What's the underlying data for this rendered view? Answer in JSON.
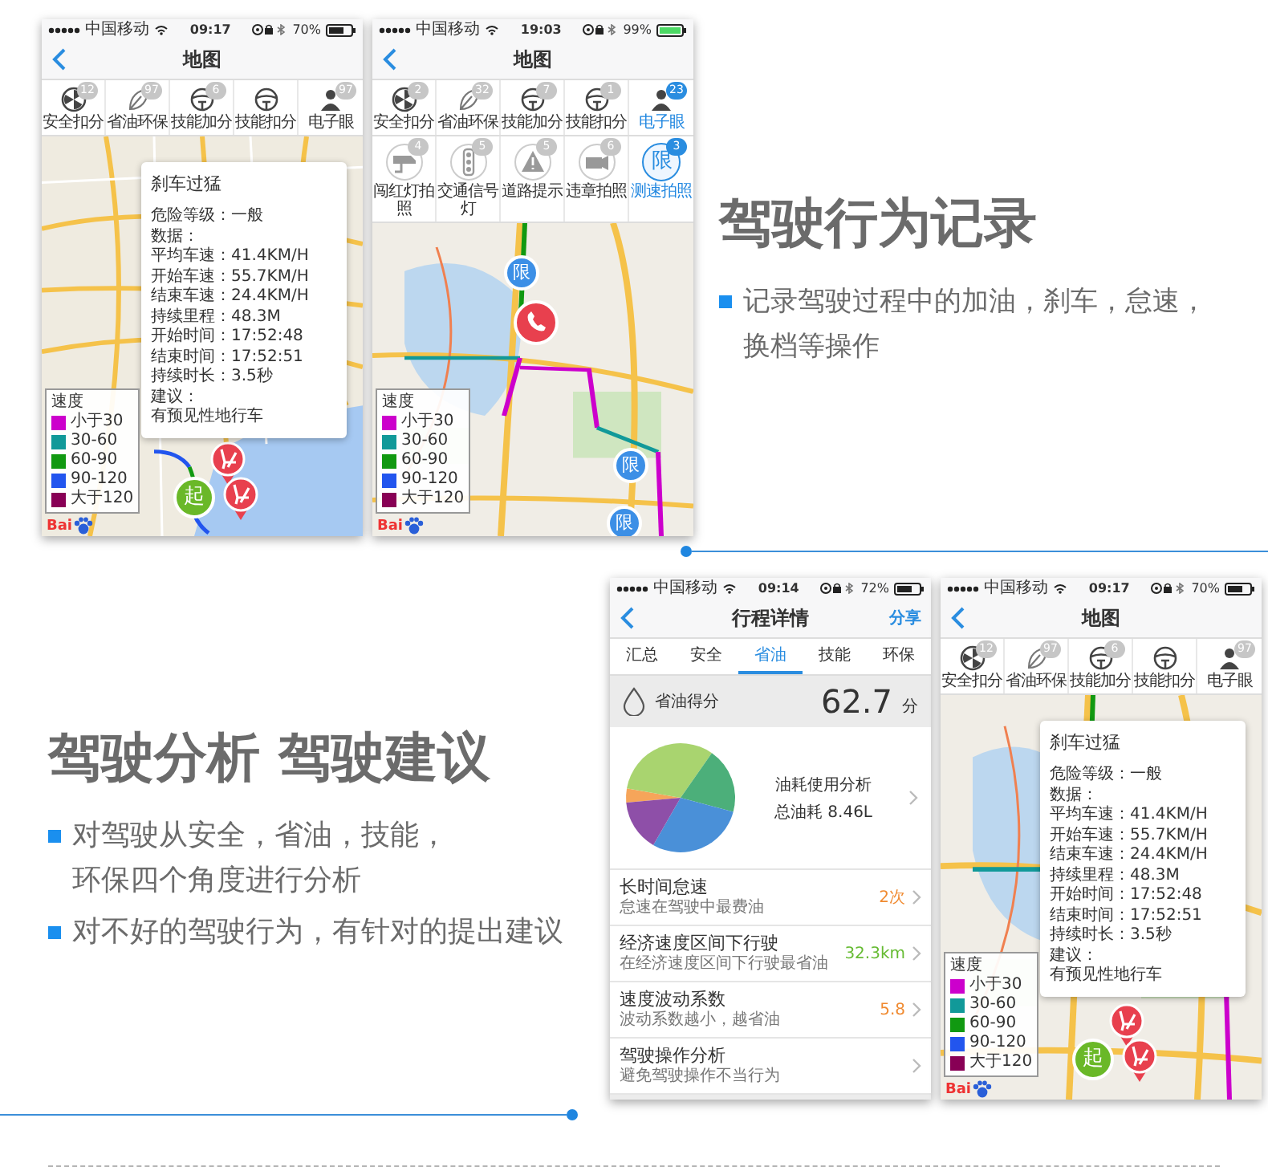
{
  "sections": [
    {
      "kind": "phones-first",
      "phones": [
        {
          "kind": "map",
          "status": {
            "carrier": "中国移动",
            "time": "09:17",
            "battery": "70%",
            "charging": false
          },
          "nav": {
            "title": "地图"
          },
          "categories": [
            {
              "kind": "hazard",
              "label": "安全扣分",
              "badge": "12",
              "selected": false
            },
            {
              "kind": "leaf",
              "label": "省油环保",
              "badge": "97",
              "selected": false
            },
            {
              "kind": "wheel",
              "label": "技能加分",
              "badge": "6",
              "selected": false
            },
            {
              "kind": "wheel",
              "label": "技能扣分",
              "selected": false
            },
            {
              "kind": "person",
              "label": "电子眼",
              "badge": "97",
              "selected": false
            }
          ],
          "popup": {
            "title": "刹车过猛",
            "lines": [
              "危险等级：一般",
              "数据：",
              "平均车速：41.4KM/H",
              "开始车速：55.7KM/H",
              "结束车速：24.4KM/H",
              "持续里程：48.3M",
              "开始时间：17:52:48",
              "结束时间：17:52:51",
              "持续时长：3.5秒",
              "建议：",
              "有预见性地行车"
            ]
          },
          "legend": {
            "title": "速度",
            "items": [
              {
                "label": "小于30",
                "color": "#cc00cc"
              },
              {
                "label": "30-60",
                "color": "#119999"
              },
              {
                "label": "60-90",
                "color": "#119911"
              },
              {
                "label": "90-120",
                "color": "#2255ee"
              },
              {
                "label": "大于120",
                "color": "#880055"
              }
            ]
          },
          "markers": [
            {
              "kind": "brake"
            },
            {
              "kind": "start",
              "text": "起"
            },
            {
              "kind": "brake"
            }
          ],
          "logo": "Bai"
        },
        {
          "kind": "map",
          "status": {
            "carrier": "中国移动",
            "time": "19:03",
            "battery": "99%",
            "charging": true
          },
          "nav": {
            "title": "地图"
          },
          "categories": [
            {
              "kind": "hazard",
              "label": "安全扣分",
              "badge": "2",
              "selected": false
            },
            {
              "kind": "leaf",
              "label": "省油环保",
              "badge": "32",
              "selected": false
            },
            {
              "kind": "wheel",
              "label": "技能加分",
              "badge": "7",
              "selected": false
            },
            {
              "kind": "wheel",
              "label": "技能扣分",
              "badge": "1",
              "selected": false
            },
            {
              "kind": "person",
              "label": "电子眼",
              "badge": "23",
              "selected": true
            }
          ],
          "subcategories": [
            {
              "kind": "cctv",
              "label": "闯红灯拍照",
              "badge": "4",
              "selected": false
            },
            {
              "kind": "light",
              "label": "交通信号灯",
              "badge": "5",
              "selected": false
            },
            {
              "kind": "warning",
              "label": "道路提示",
              "badge": "5",
              "selected": false
            },
            {
              "kind": "camera",
              "label": "违章拍照",
              "badge": "6",
              "selected": false
            },
            {
              "kind": "limit",
              "glyph": "限",
              "label": "测速拍照",
              "badge": "3",
              "selected": true
            }
          ],
          "legend": {
            "title": "速度",
            "items": [
              {
                "label": "小于30",
                "color": "#cc00cc"
              },
              {
                "label": "30-60",
                "color": "#119999"
              },
              {
                "label": "60-90",
                "color": "#119911"
              },
              {
                "label": "90-120",
                "color": "#2255ee"
              },
              {
                "label": "大于120",
                "color": "#880055"
              }
            ]
          },
          "markers": [
            {
              "kind": "limit",
              "text": "限"
            },
            {
              "kind": "phone"
            },
            {
              "kind": "limit",
              "text": "限"
            },
            {
              "kind": "limit",
              "text": "限"
            }
          ],
          "logo": "Bai"
        }
      ],
      "heading": "驾驶行为记录",
      "bullets": [
        {
          "lines": [
            "记录驾驶过程中的加油，刹车，怠速，",
            "换档等操作"
          ]
        }
      ]
    },
    {
      "kind": "text-first",
      "heading": "驾驶分析 驾驶建议",
      "bullets": [
        {
          "lines": [
            "对驾驶从安全，省油，技能，",
            "环保四个角度进行分析"
          ]
        },
        {
          "lines": [
            "对不好的驾驶行为，有针对的提出建议"
          ]
        }
      ],
      "phones": [
        {
          "kind": "detail",
          "status": {
            "carrier": "中国移动",
            "time": "09:14",
            "battery": "72%",
            "charging": false
          },
          "nav": {
            "title": "行程详情",
            "action": "分享"
          },
          "tabs": [
            {
              "label": "汇总",
              "selected": false
            },
            {
              "label": "安全",
              "selected": false
            },
            {
              "label": "省油",
              "selected": true
            },
            {
              "label": "技能",
              "selected": false
            },
            {
              "label": "环保",
              "selected": false
            }
          ],
          "score": {
            "label": "省油得分",
            "value": "62.7",
            "unit": "分"
          },
          "analysis": {
            "title": "油耗使用分析",
            "total": "总油耗 8.46L"
          },
          "rows": [
            {
              "title": "长时间怠速",
              "subtitle": "怠速在驾驶中最费油",
              "value": "2次",
              "color": "#f08a30"
            },
            {
              "title": "经济速度区间下行驶",
              "subtitle": "在经济速度区间下行驶最省油",
              "value": "32.3km",
              "color": "#66bb33"
            },
            {
              "title": "速度波动系数",
              "subtitle": "波动系数越小，越省油",
              "value": "5.8",
              "color": "#f08a30"
            },
            {
              "title": "驾驶操作分析",
              "subtitle": "避免驾驶操作不当行为"
            }
          ]
        },
        {
          "kind": "map",
          "status": {
            "carrier": "中国移动",
            "time": "09:17",
            "battery": "70%",
            "charging": false
          },
          "nav": {
            "title": "地图"
          },
          "categories": [
            {
              "kind": "hazard",
              "label": "安全扣分",
              "badge": "12",
              "selected": false
            },
            {
              "kind": "leaf",
              "label": "省油环保",
              "badge": "97",
              "selected": false
            },
            {
              "kind": "wheel",
              "label": "技能加分",
              "badge": "6",
              "selected": false
            },
            {
              "kind": "wheel",
              "label": "技能扣分",
              "selected": false
            },
            {
              "kind": "person",
              "label": "电子眼",
              "badge": "97",
              "selected": false
            }
          ],
          "popup": {
            "title": "刹车过猛",
            "lines": [
              "危险等级：一般",
              "数据：",
              "平均车速：41.4KM/H",
              "开始车速：55.7KM/H",
              "结束车速：24.4KM/H",
              "持续里程：48.3M",
              "开始时间：17:52:48",
              "结束时间：17:52:51",
              "持续时长：3.5秒",
              "建议：",
              "有预见性地行车"
            ]
          },
          "legend": {
            "title": "速度",
            "items": [
              {
                "label": "小于30",
                "color": "#cc00cc"
              },
              {
                "label": "30-60",
                "color": "#119999"
              },
              {
                "label": "60-90",
                "color": "#119911"
              },
              {
                "label": "90-120",
                "color": "#2255ee"
              },
              {
                "label": "大于120",
                "color": "#880055"
              }
            ]
          },
          "markers": [
            {
              "kind": "brake"
            },
            {
              "kind": "start",
              "text": "起"
            },
            {
              "kind": "brake"
            }
          ],
          "logo": "Bai"
        }
      ]
    }
  ]
}
